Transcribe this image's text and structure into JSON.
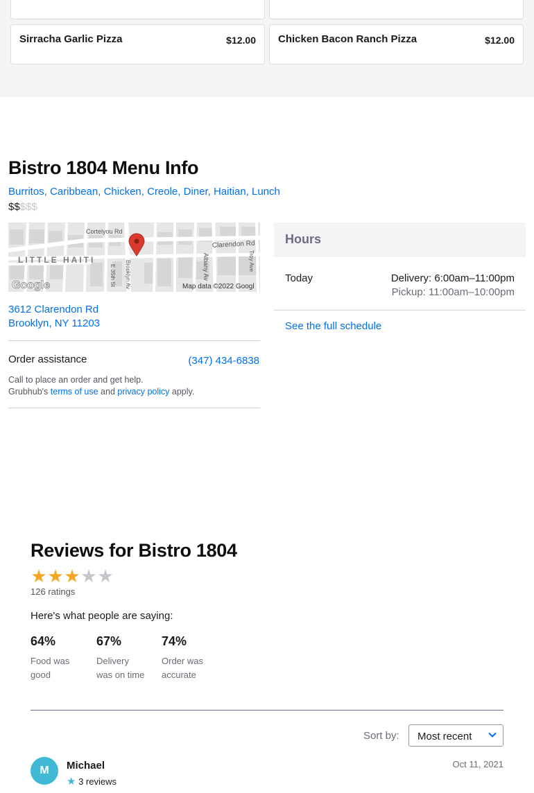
{
  "menu_items": [
    {
      "name": "",
      "price": ""
    },
    {
      "name": "",
      "price": ""
    },
    {
      "name": "Sirracha Garlic Pizza",
      "price": "$12.00"
    },
    {
      "name": "Chicken Bacon Ranch Pizza",
      "price": "$12.00"
    }
  ],
  "info": {
    "title": "Bistro 1804 Menu Info",
    "cuisines": "Burritos, Caribbean, Chicken, Creole, Diner, Haitian, Lunch",
    "price_on": "$$",
    "price_off": "$$$"
  },
  "map": {
    "labels": {
      "cortelyou": "Cortelyou Rd",
      "clarendon": "Clarendon Rd",
      "neighborhood": "LITTLE HAITI",
      "e35": "E 35th St",
      "brooklyn": "Brooklyn Av",
      "albany": "Albany Av",
      "troy": "Troy Ave",
      "google": "Google",
      "attribution": "Map data ©2022 Googl"
    }
  },
  "address": {
    "line1": "3612 Clarendon Rd",
    "line2": "Brooklyn, NY 11203"
  },
  "assistance": {
    "label": "Order assistance",
    "phone": "(347) 434-6838",
    "help_text": "Call to place an order and get help.",
    "legal_prefix": "Grubhub's",
    "terms_link": "terms of use",
    "and": "and",
    "privacy_link": "privacy policy",
    "legal_suffix": "apply."
  },
  "hours": {
    "heading": "Hours",
    "today_label": "Today",
    "delivery": "Delivery: 6:00am–11:00pm",
    "pickup": "Pickup: 11:00am–10:00pm",
    "schedule_link": "See the full schedule"
  },
  "reviews": {
    "title": "Reviews for Bistro 1804",
    "rating": 3,
    "rating_max": 5,
    "rating_count": "126 ratings",
    "saying": "Here's what people are saying:",
    "stats": [
      {
        "pct": "64%",
        "label_line1": "Food was",
        "label_line2": "good"
      },
      {
        "pct": "67%",
        "label_line1": "Delivery",
        "label_line2": "was on time"
      },
      {
        "pct": "74%",
        "label_line1": "Order was",
        "label_line2": "accurate"
      }
    ],
    "sort_label": "Sort by:",
    "sort_value": "Most recent",
    "first_review": {
      "initial": "M",
      "name": "Michael",
      "review_count": "3 reviews",
      "date": "Oct 11, 2021"
    }
  },
  "colors": {
    "link": "#0070eb",
    "star": "#f5a623",
    "avatar": "#3fb9d4",
    "band": "#f4f4f6"
  }
}
